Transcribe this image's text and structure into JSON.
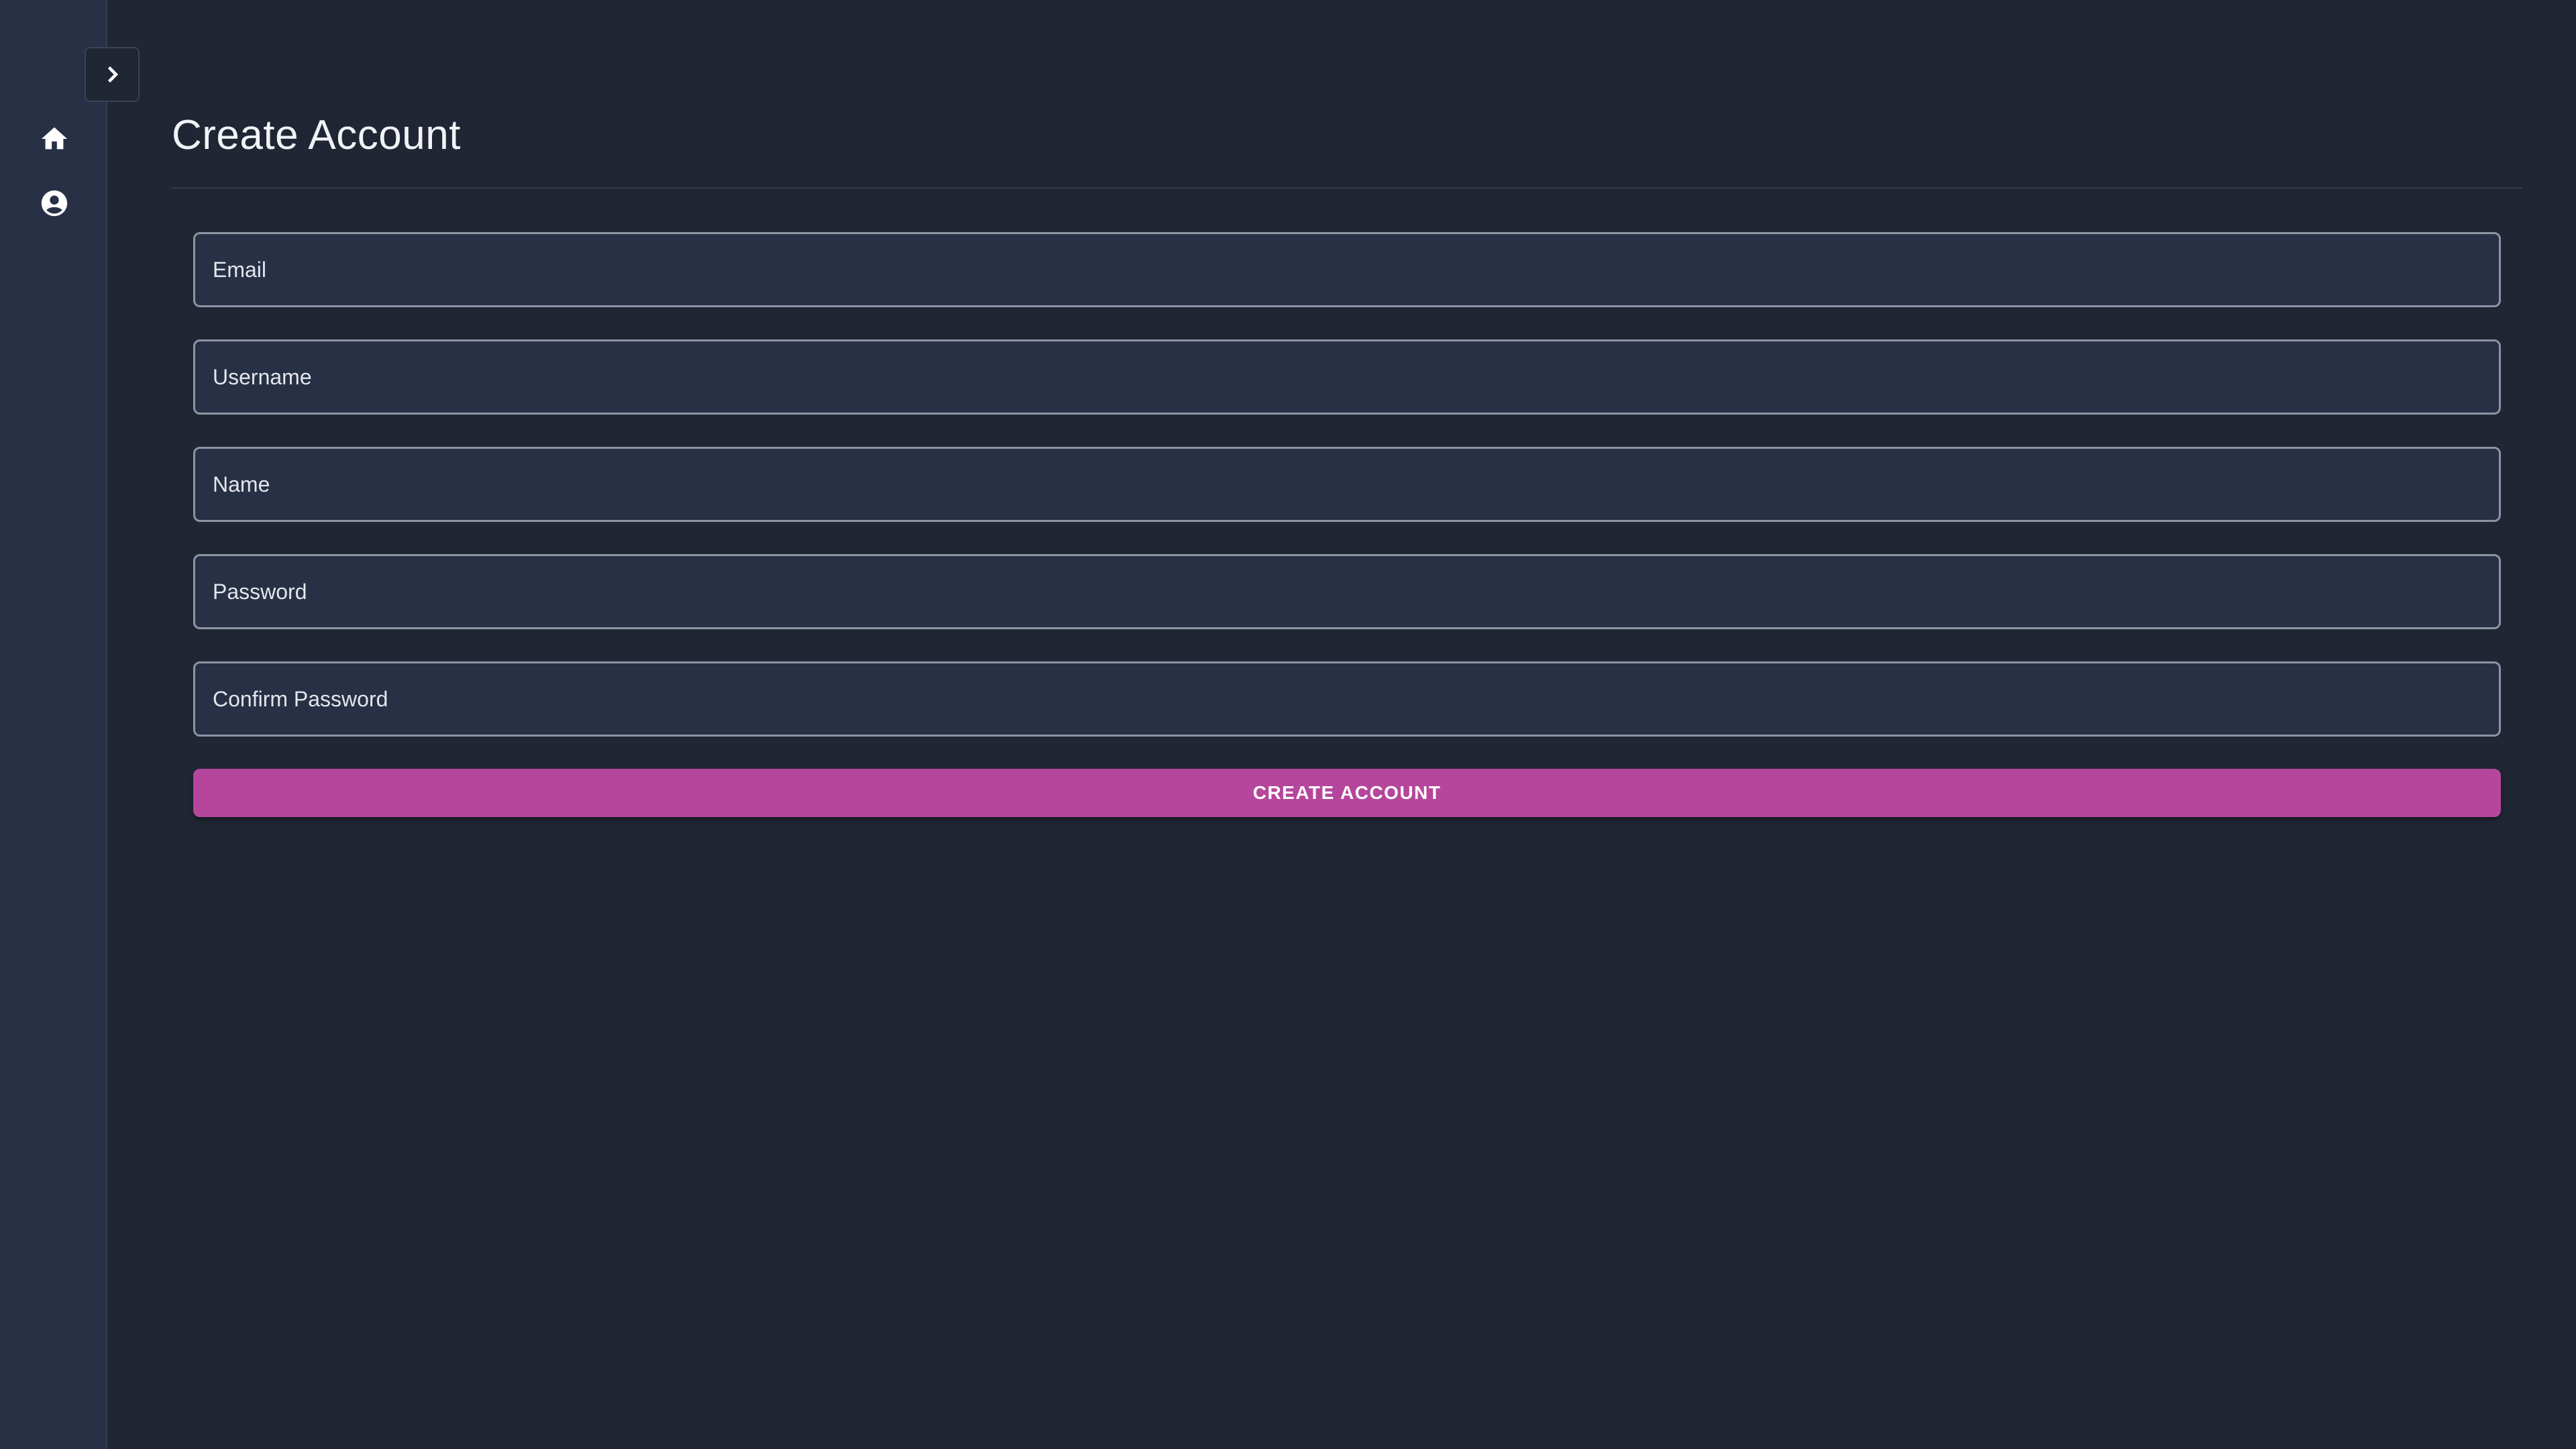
{
  "sidebar": {
    "items": [
      {
        "icon": "home-icon"
      },
      {
        "icon": "account-circle-icon"
      }
    ],
    "toggle_icon": "chevron-right-icon"
  },
  "main": {
    "title": "Create Account",
    "form": {
      "email": {
        "placeholder": "Email",
        "value": ""
      },
      "username": {
        "placeholder": "Username",
        "value": ""
      },
      "name": {
        "placeholder": "Name",
        "value": ""
      },
      "password": {
        "placeholder": "Password",
        "value": ""
      },
      "confirm_password": {
        "placeholder": "Confirm Password",
        "value": ""
      },
      "submit_label": "CREATE ACCOUNT"
    }
  },
  "colors": {
    "background": "#202633",
    "sidebar": "#283045",
    "accent": "#b5469c",
    "field_border": "#8e94a3"
  }
}
